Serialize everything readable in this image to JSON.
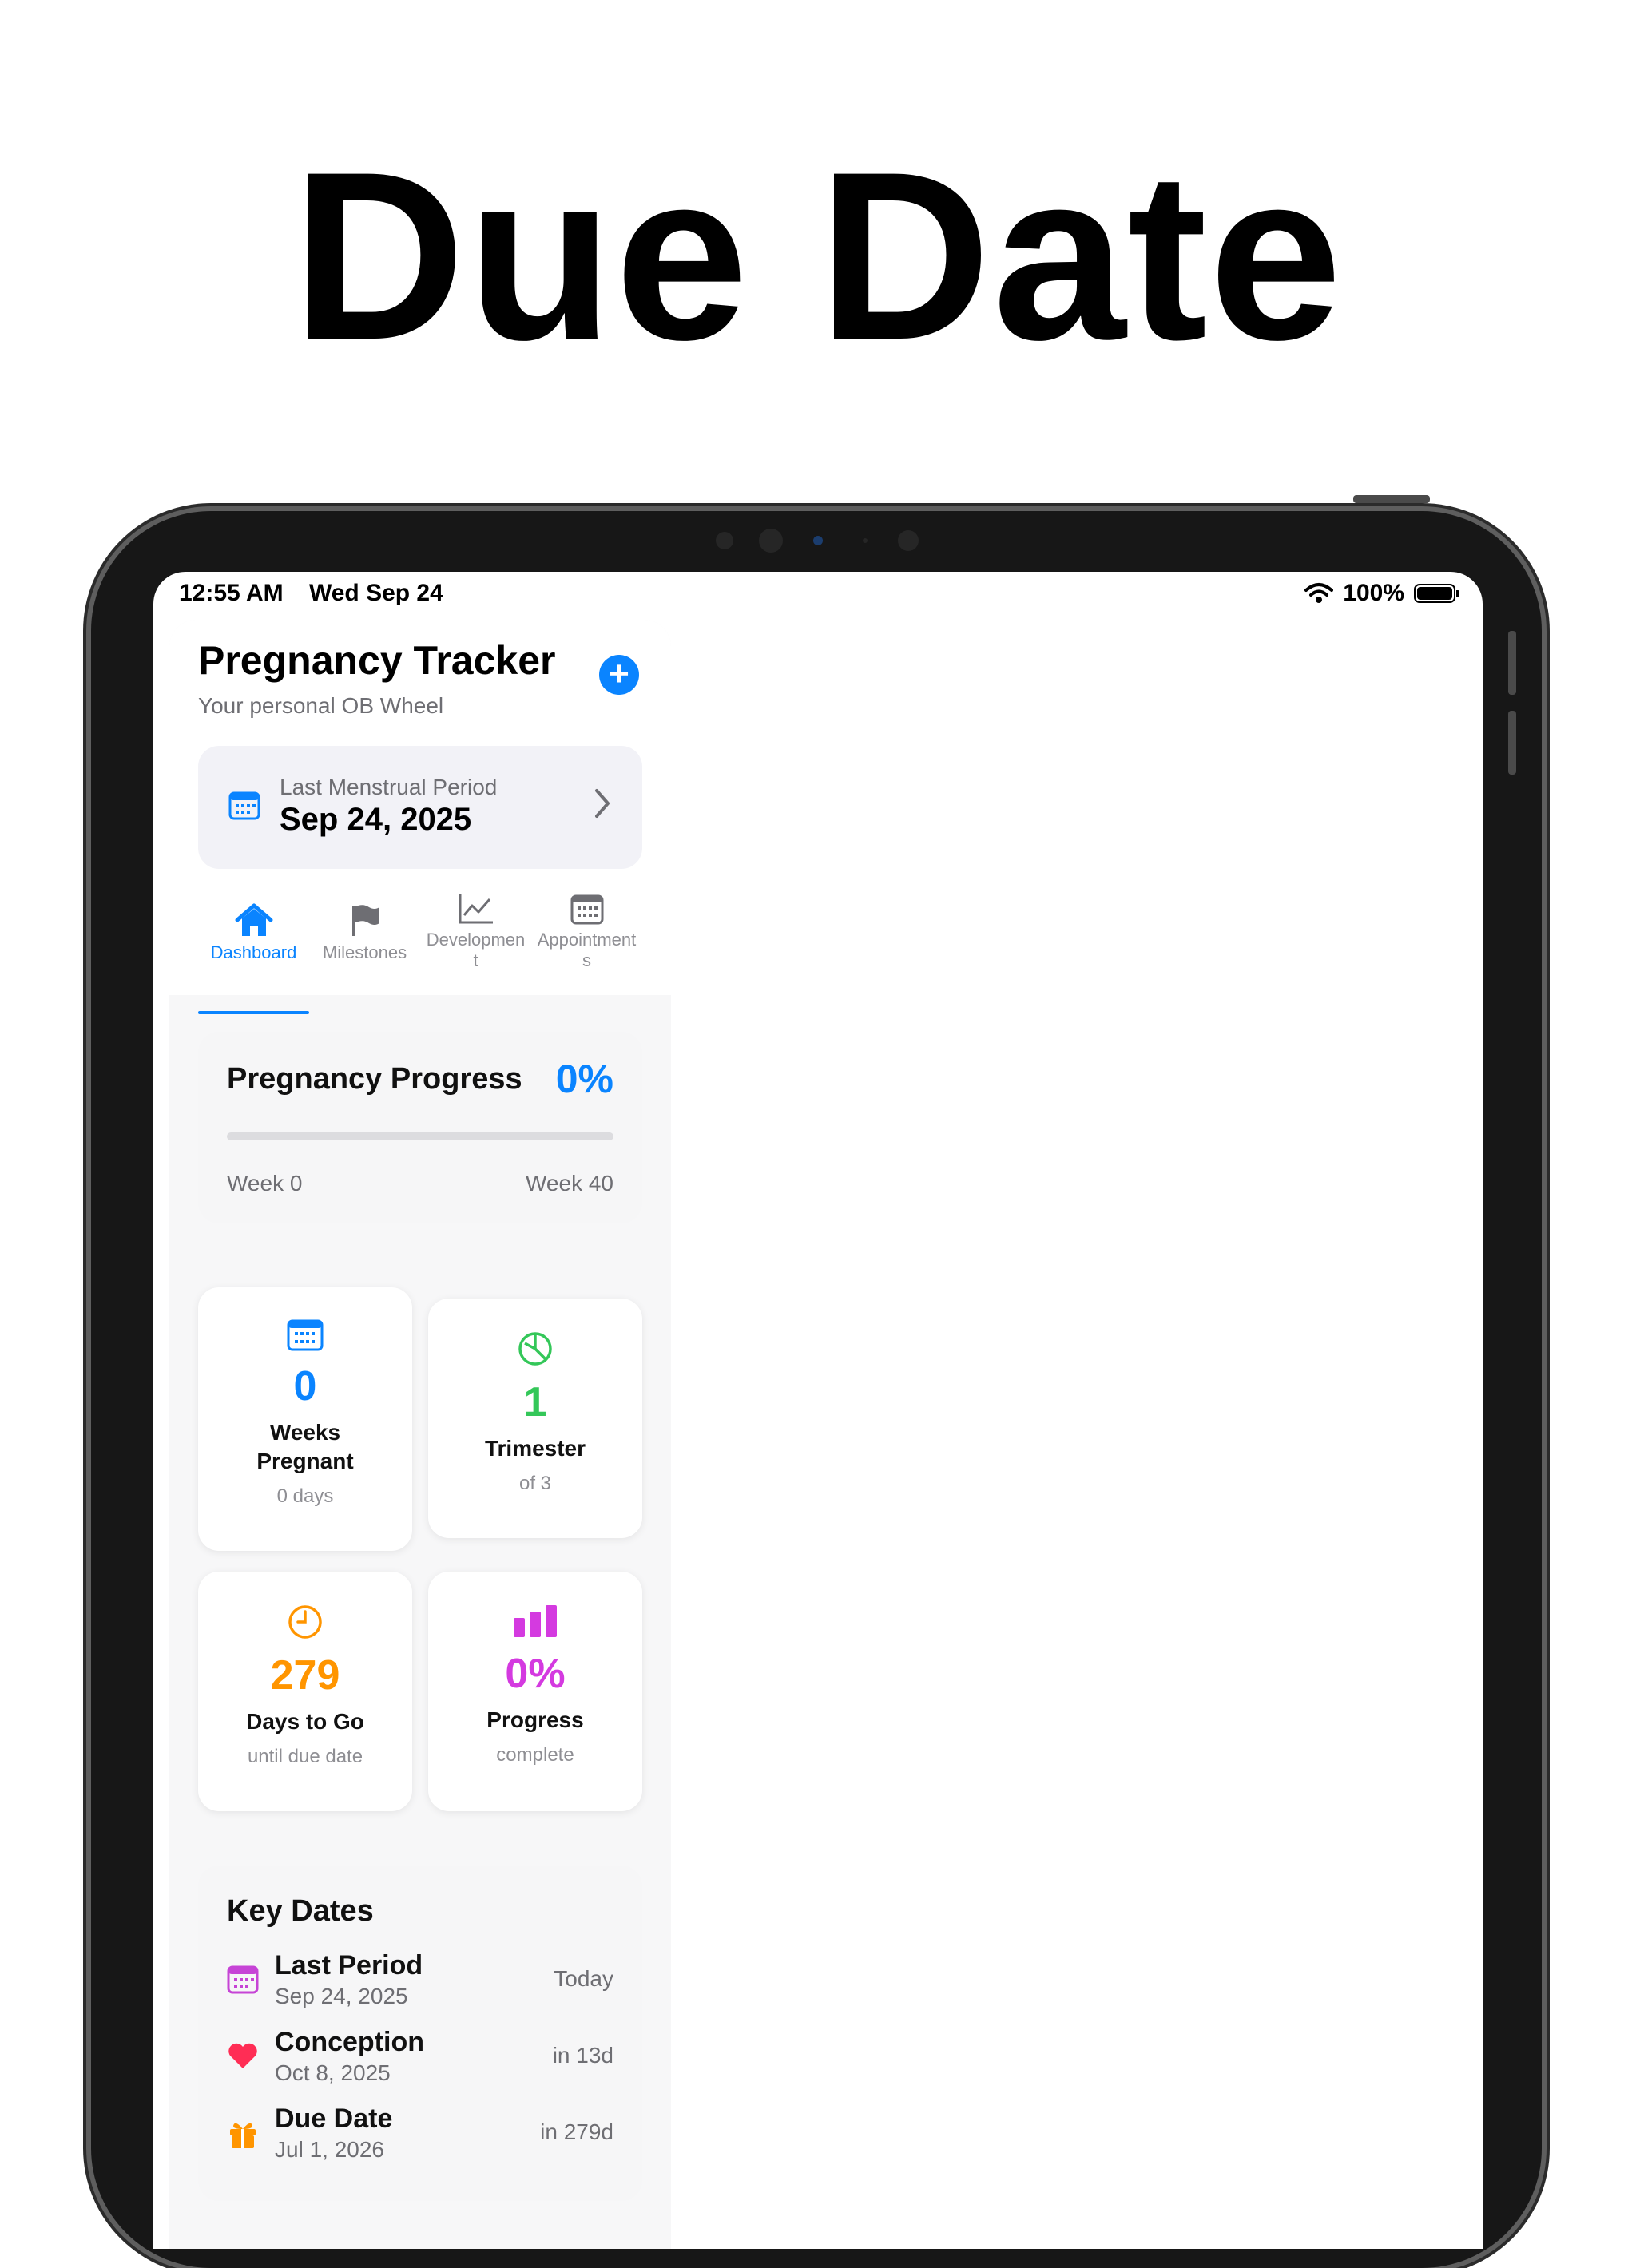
{
  "headline": "Due Date",
  "status_bar": {
    "time": "12:55 AM",
    "date": "Wed Sep 24",
    "battery": "100%"
  },
  "app": {
    "title": "Pregnancy Tracker",
    "subtitle": "Your personal OB Wheel"
  },
  "lmp": {
    "label": "Last Menstrual Period",
    "value": "Sep 24, 2025"
  },
  "tabs": [
    {
      "label": "Dashboard",
      "icon": "house-icon",
      "active": true
    },
    {
      "label": "Milestones",
      "icon": "flag-icon"
    },
    {
      "label_line1": "Developmen",
      "label_line2": "t",
      "icon": "chart-line-icon"
    },
    {
      "label_line1": "Appointment",
      "label_line2": "s",
      "icon": "calendar-icon"
    }
  ],
  "progress": {
    "title": "Pregnancy Progress",
    "percent": "0%",
    "fraction": 0,
    "start_label": "Week 0",
    "end_label": "Week 40"
  },
  "stats": [
    {
      "value": "0",
      "label_line1": "Weeks",
      "label_line2": "Pregnant",
      "sub": "0 days",
      "color": "#0a84ff",
      "icon": "calendar-icon"
    },
    {
      "value": "1",
      "label": "Trimester",
      "sub": "of 3",
      "color": "#34c759",
      "icon": "pie-chart-icon"
    },
    {
      "value": "279",
      "label": "Days to Go",
      "sub": "until due date",
      "color": "#ff9500",
      "icon": "clock-icon"
    },
    {
      "value": "0%",
      "label": "Progress",
      "sub": "complete",
      "color": "#d43ae0",
      "icon": "bar-chart-icon"
    }
  ],
  "key_dates": {
    "title": "Key Dates",
    "items": [
      {
        "name": "Last Period",
        "date": "Sep 24, 2025",
        "relative": "Today",
        "icon": "calendar-icon",
        "color": "#c644d6"
      },
      {
        "name": "Conception",
        "date": "Oct 8, 2025",
        "relative": "in 13d",
        "icon": "heart-icon",
        "color": "#ff2d55"
      },
      {
        "name": "Due Date",
        "date": "Jul 1, 2026",
        "relative": "in 279d",
        "icon": "gift-icon",
        "color": "#ff9500"
      }
    ]
  }
}
